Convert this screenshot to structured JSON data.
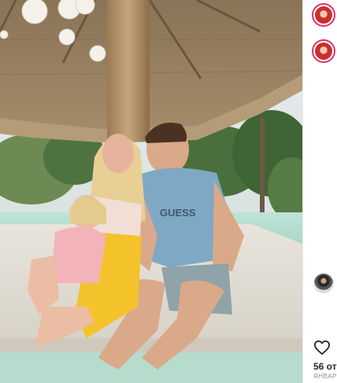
{
  "post": {
    "likes_text": "56 от",
    "date_text": "ЯНВАР",
    "photo_print_text": "GUESS"
  },
  "icons": {
    "like": "heart-icon"
  },
  "colors": {
    "story_ring": "#e1306c",
    "text_primary": "#262626",
    "text_secondary": "#8e8e8e"
  }
}
